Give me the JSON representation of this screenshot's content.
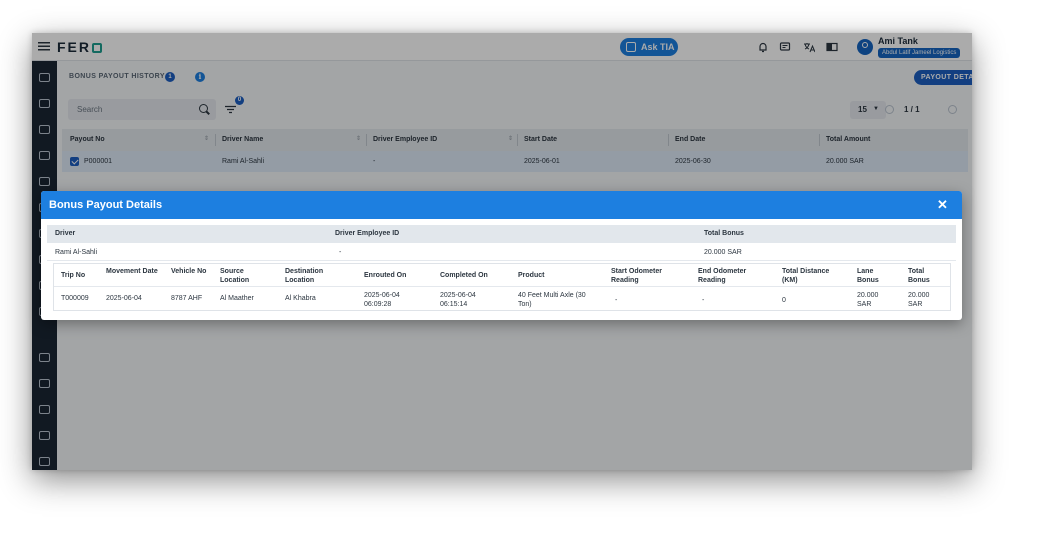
{
  "header": {
    "brand": "FER",
    "ask_label": "Ask TIA",
    "user_name": "Ami Tank",
    "user_org": "Abdul Latif Jameel Logistics"
  },
  "page": {
    "title": "BONUS PAYOUT HISTORY",
    "count_badge": "1",
    "details_button": "PAYOUT DETAILS"
  },
  "search": {
    "placeholder": "Search",
    "filter_badge": "0"
  },
  "pagination": {
    "per_page": "15",
    "page_info": "1 / 1"
  },
  "table": {
    "columns": [
      "Payout No",
      "Driver Name",
      "Driver Employee ID",
      "Start Date",
      "End Date",
      "Total Amount"
    ],
    "rows": [
      {
        "payout_no": "P000001",
        "driver_name": "Rami Al-Sahli",
        "employee_id": "-",
        "start_date": "2025-06-01",
        "end_date": "2025-06-30",
        "total_amount": "20.000 SAR"
      }
    ]
  },
  "modal": {
    "title": "Bonus Payout Details",
    "summary_headers": [
      "Driver",
      "Driver Employee ID",
      "Total Bonus"
    ],
    "summary": {
      "driver": "Rami Al-Sahli",
      "employee_id": "-",
      "total_bonus": "20.000 SAR"
    },
    "trip_headers": [
      "Trip No",
      "Movement Date",
      "Vehicle No",
      "Source Location",
      "Destination Location",
      "Enrouted On",
      "Completed On",
      "Product",
      "Start Odometer Reading",
      "End Odometer Reading",
      "Total Distance (KM)",
      "Lane Bonus",
      "Total Bonus"
    ],
    "trips": [
      {
        "trip_no": "T000009",
        "movement_date": "2025-06-04",
        "vehicle_no": "8787 AHF",
        "source": "Al Maather",
        "destination": "Al Khabra",
        "enrouted_on": "2025-06-04 06:09:28",
        "completed_on": "2025-06-04 06:15:14",
        "product": "40 Feet Multi Axle (30 Ton)",
        "start_odometer": "-",
        "end_odometer": "-",
        "total_distance": "0",
        "lane_bonus": "20.000 SAR",
        "total_bonus": "20.000 SAR"
      }
    ]
  },
  "colors": {
    "accent": "#1d7fe0",
    "primary_dark": "#1d5fc0",
    "sidebar": "#1a2633"
  }
}
